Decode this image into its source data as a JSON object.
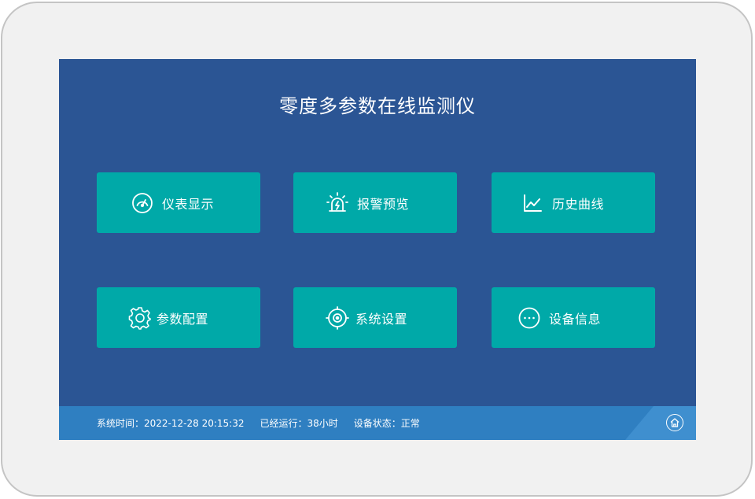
{
  "app": {
    "title": "零度多参数在线监测仪"
  },
  "tiles": [
    {
      "label": "仪表显示",
      "icon": "gauge-icon"
    },
    {
      "label": "报警预览",
      "icon": "alarm-icon"
    },
    {
      "label": "历史曲线",
      "icon": "line-chart-icon"
    },
    {
      "label": "参数配置",
      "icon": "gear-icon"
    },
    {
      "label": "系统设置",
      "icon": "target-icon"
    },
    {
      "label": "设备信息",
      "icon": "more-icon"
    }
  ],
  "status": {
    "time_label": "系统时间：",
    "time_value": "2022-12-28 20:15:32",
    "runtime_label": "已经运行：",
    "runtime_value": "38小时",
    "device_label": "设备状态：",
    "device_value": "正常"
  },
  "colors": {
    "screen_bg": "#2b5594",
    "tile_bg": "#00a9a8",
    "statusbar_bg": "#2f7fc1"
  },
  "footer": {
    "home_icon": "home-icon"
  }
}
